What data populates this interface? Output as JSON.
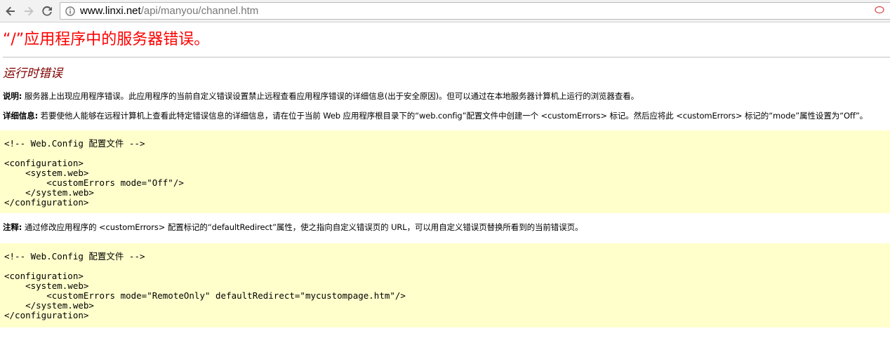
{
  "browser": {
    "url_host": "www.linxi.net",
    "url_path": "/api/manyou/channel.htm"
  },
  "page": {
    "title": "“/”应用程序中的服务器错误。",
    "subtitle": "运行时错误",
    "description_label": "说明:",
    "description_text": " 服务器上出现应用程序错误。此应用程序的当前自定义错误设置禁止远程查看应用程序错误的详细信息(出于安全原因)。但可以通过在本地服务器计算机上运行的浏览器查看。",
    "details_label": "详细信息:",
    "details_text": " 若要使他人能够在远程计算机上查看此特定错误信息的详细信息，请在位于当前 Web 应用程序根目录下的“web.config”配置文件中创建一个 <customErrors> 标记。然后应将此 <customErrors> 标记的“mode”属性设置为“Off”。",
    "code1": "<!-- Web.Config 配置文件 -->\n\n<configuration>\n    <system.web>\n        <customErrors mode=\"Off\"/>\n    </system.web>\n</configuration>",
    "note_label": "注释:",
    "note_text": " 通过修改应用程序的 <customErrors> 配置标记的“defaultRedirect”属性，使之指向自定义错误页的 URL，可以用自定义错误页替换所看到的当前错误页。",
    "code2": "<!-- Web.Config 配置文件 -->\n\n<configuration>\n    <system.web>\n        <customErrors mode=\"RemoteOnly\" defaultRedirect=\"mycustompage.htm\"/>\n    </system.web>\n</configuration>"
  }
}
